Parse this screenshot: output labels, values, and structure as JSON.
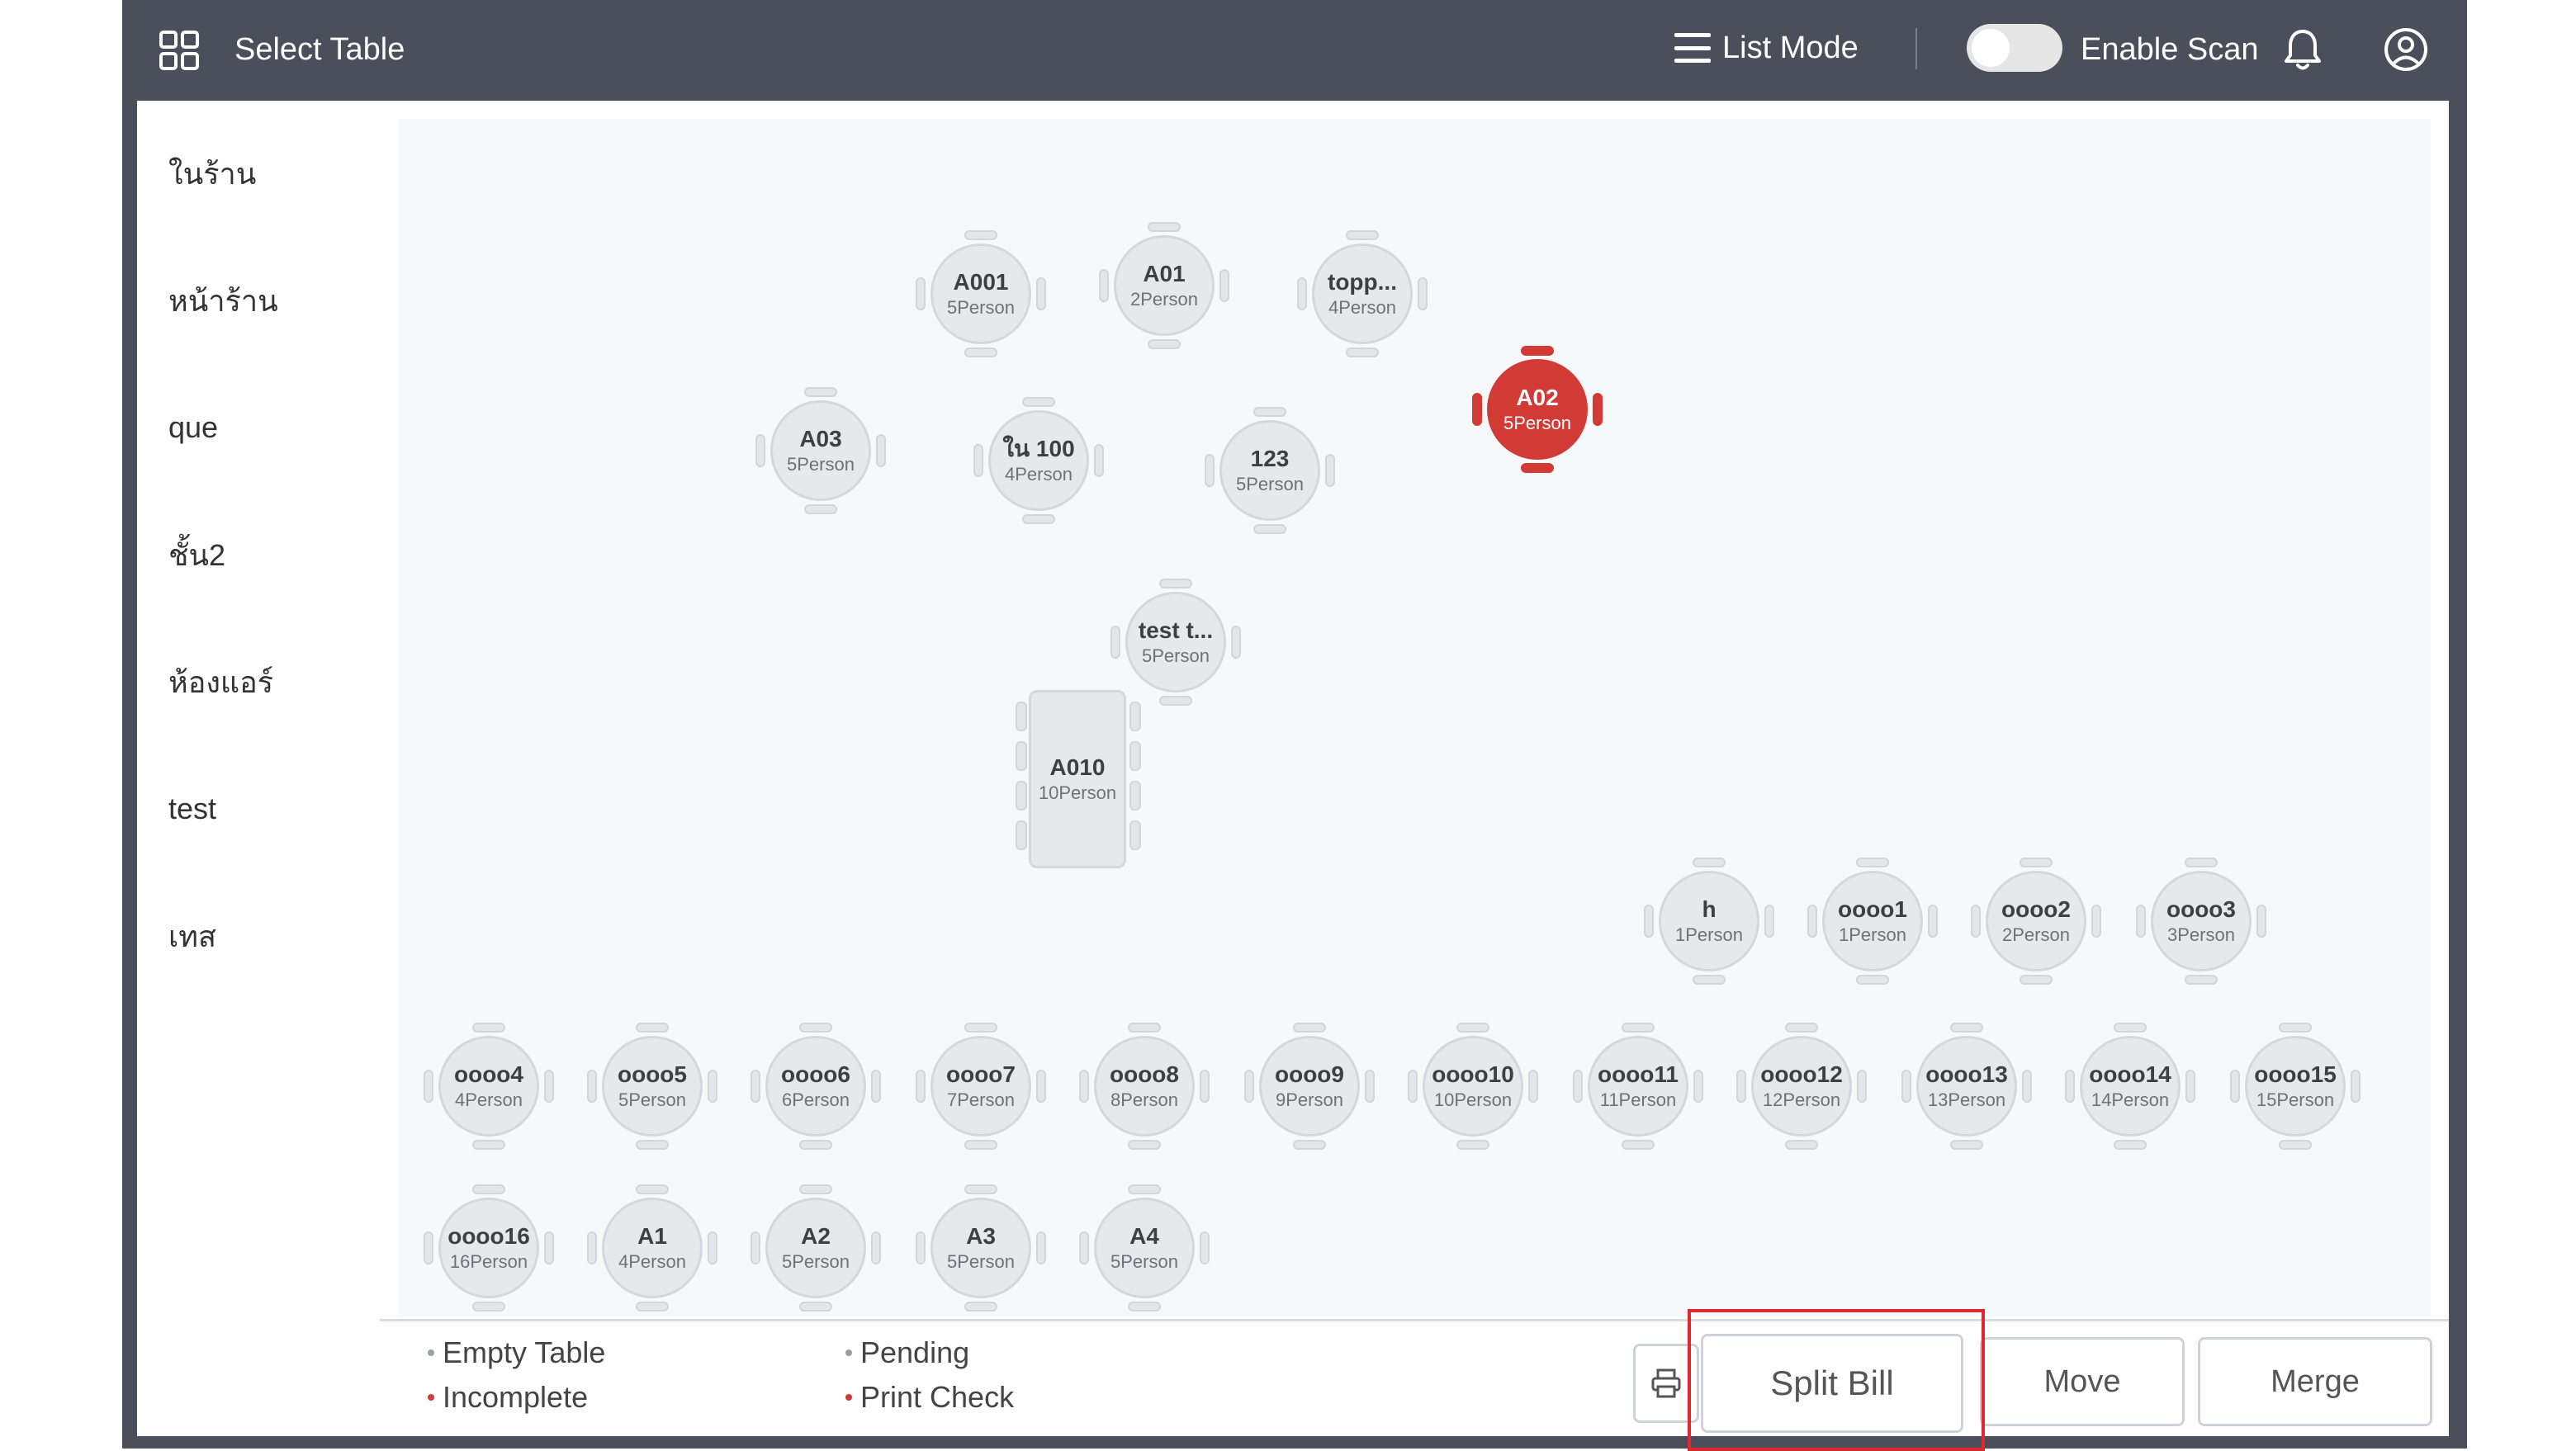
{
  "header": {
    "title": "Select Table",
    "list_mode_label": "List Mode",
    "scan_label": "Enable Scan",
    "scan_enabled": false
  },
  "sidebar": {
    "items": [
      {
        "label": "ในร้าน",
        "active": true
      },
      {
        "label": "หน้าร้าน",
        "active": false
      },
      {
        "label": "que",
        "active": false
      },
      {
        "label": "ชั้น2",
        "active": false
      },
      {
        "label": "ห้องแอร์",
        "active": false
      },
      {
        "label": "test",
        "active": false
      },
      {
        "label": "เทส",
        "active": false
      }
    ]
  },
  "tables": [
    {
      "name": "A001",
      "capacity": "5Person",
      "status": "empty"
    },
    {
      "name": "A01",
      "capacity": "2Person",
      "status": "empty"
    },
    {
      "name": "topp...",
      "capacity": "4Person",
      "status": "empty"
    },
    {
      "name": "A02",
      "capacity": "5Person",
      "status": "incomplete"
    },
    {
      "name": "A03",
      "capacity": "5Person",
      "status": "empty"
    },
    {
      "name": "ใน 100",
      "capacity": "4Person",
      "status": "empty"
    },
    {
      "name": "123",
      "capacity": "5Person",
      "status": "empty"
    },
    {
      "name": "test t...",
      "capacity": "5Person",
      "status": "empty"
    },
    {
      "name": "A010",
      "capacity": "10Person",
      "status": "empty"
    },
    {
      "name": "h",
      "capacity": "1Person",
      "status": "empty"
    },
    {
      "name": "oooo1",
      "capacity": "1Person",
      "status": "empty"
    },
    {
      "name": "oooo2",
      "capacity": "2Person",
      "status": "empty"
    },
    {
      "name": "oooo3",
      "capacity": "3Person",
      "status": "empty"
    },
    {
      "name": "oooo4",
      "capacity": "4Person",
      "status": "empty"
    },
    {
      "name": "oooo5",
      "capacity": "5Person",
      "status": "empty"
    },
    {
      "name": "oooo6",
      "capacity": "6Person",
      "status": "empty"
    },
    {
      "name": "oooo7",
      "capacity": "7Person",
      "status": "empty"
    },
    {
      "name": "oooo8",
      "capacity": "8Person",
      "status": "empty"
    },
    {
      "name": "oooo9",
      "capacity": "9Person",
      "status": "empty"
    },
    {
      "name": "oooo10",
      "capacity": "10Person",
      "status": "empty"
    },
    {
      "name": "oooo11",
      "capacity": "11Person",
      "status": "empty"
    },
    {
      "name": "oooo12",
      "capacity": "12Person",
      "status": "empty"
    },
    {
      "name": "oooo13",
      "capacity": "13Person",
      "status": "empty"
    },
    {
      "name": "oooo14",
      "capacity": "14Person",
      "status": "empty"
    },
    {
      "name": "oooo15",
      "capacity": "15Person",
      "status": "empty"
    },
    {
      "name": "oooo16",
      "capacity": "16Person",
      "status": "empty"
    },
    {
      "name": "A1",
      "capacity": "4Person",
      "status": "empty"
    },
    {
      "name": "A2",
      "capacity": "5Person",
      "status": "empty"
    },
    {
      "name": "A3",
      "capacity": "5Person",
      "status": "empty"
    },
    {
      "name": "A4",
      "capacity": "5Person",
      "status": "empty"
    }
  ],
  "legend": {
    "empty": {
      "label": "Empty Table",
      "color": "#9aa0a8"
    },
    "pending": {
      "label": "Pending",
      "color": "#9aa0a8"
    },
    "incomplete": {
      "label": "Incomplete",
      "color": "#d23b35"
    },
    "print_check": {
      "label": "Print Check",
      "color": "#d23b35"
    }
  },
  "actions": {
    "split_bill": "Split Bill",
    "move": "Move",
    "merge": "Merge"
  },
  "colors": {
    "header_bg": "#4a4f5b",
    "accent_red": "#d23b35",
    "highlight_box": "#e0282e"
  }
}
